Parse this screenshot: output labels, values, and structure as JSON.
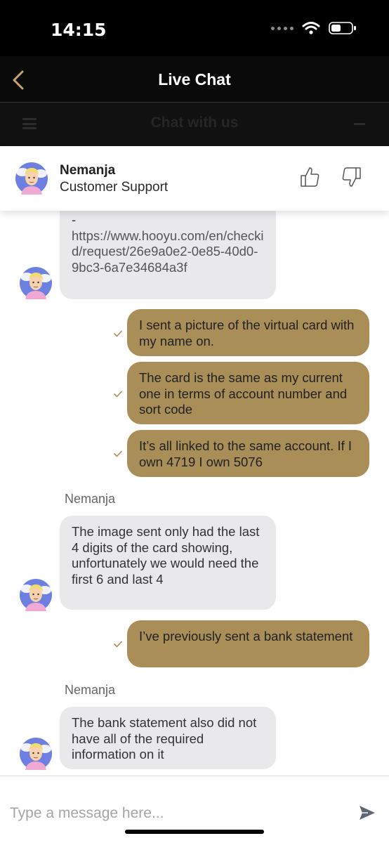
{
  "status_bar": {
    "time": "14:15"
  },
  "nav": {
    "title": "Live Chat"
  },
  "subbar": {
    "title": "Chat with us"
  },
  "agent": {
    "name": "Nemanja",
    "role": "Customer Support"
  },
  "messages": [
    {
      "type": "incoming",
      "lines": [
        "-",
        "https://www.hooyu.com/en/checkid/request/26e9a0e2-0e85-40d0-9bc3-6a7e34684a3f"
      ]
    },
    {
      "type": "outgoing",
      "text": "I sent a picture of the virtual card with my name on."
    },
    {
      "type": "outgoing",
      "text": "The card is the same as my current one in terms of account number and sort code"
    },
    {
      "type": "outgoing",
      "text": "It’s all linked to the same account. If I own 4719 I own 5076"
    },
    {
      "type": "sender",
      "text": "Nemanja"
    },
    {
      "type": "incoming",
      "text": "The image sent only had the last 4 digits of the card showing, unfortunately we would need the first 6 and last 4"
    },
    {
      "type": "outgoing",
      "text": "I’ve previously sent a bank statement"
    },
    {
      "type": "sender",
      "text": "Nemanja"
    },
    {
      "type": "incoming",
      "text": "The bank statement also did not have all of the required information on it"
    }
  ],
  "composer": {
    "placeholder": "Type a message here..."
  },
  "colors": {
    "outgoing_bubble": "#a98e58",
    "incoming_bubble": "#e9e9eb",
    "header_bg": "#000000",
    "back_chevron": "#c8a46a"
  },
  "icons": [
    "back-chevron-icon",
    "menu-icon",
    "minimize-icon",
    "thumbs-up-icon",
    "thumbs-down-icon",
    "check-icon",
    "send-icon",
    "wifi-icon",
    "battery-icon"
  ]
}
